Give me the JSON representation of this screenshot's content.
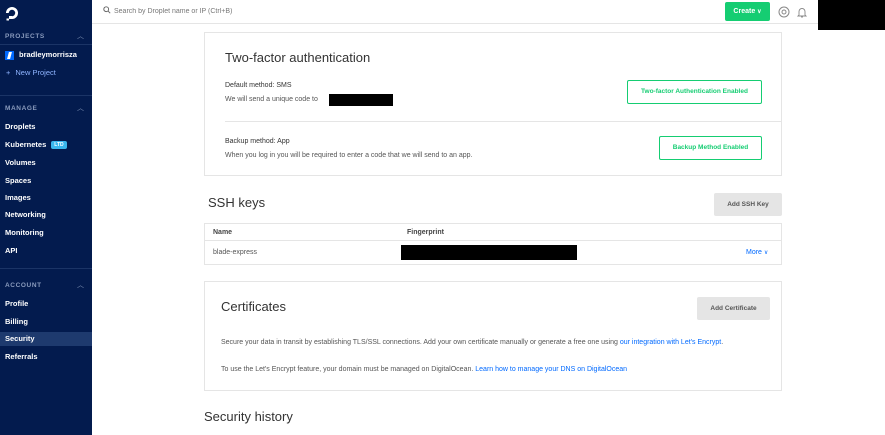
{
  "sidebar": {
    "projects_label": "PROJECTS",
    "project_name": "bradleymorrisza",
    "new_project": "New Project",
    "manage_label": "MANAGE",
    "manage_items": [
      "Droplets",
      "Kubernetes",
      "Volumes",
      "Spaces",
      "Images",
      "Networking",
      "Monitoring",
      "API"
    ],
    "kubernetes_badge": "LTD",
    "account_label": "ACCOUNT",
    "account_items": [
      "Profile",
      "Billing",
      "Security",
      "Referrals"
    ],
    "active_item": "Security",
    "colors": {
      "background": "#031b4e",
      "active": "#1e3a6e"
    }
  },
  "topbar": {
    "search_placeholder": "Search by Droplet name or IP (Ctrl+B)",
    "create_label": "Create",
    "icons": [
      "search-icon",
      "help-icon",
      "notification-bell-icon"
    ],
    "accent": "#15cd72"
  },
  "two_factor": {
    "title": "Two-factor authentication",
    "default_method_label": "Default method: SMS",
    "default_method_desc": "We will send a unique code to",
    "default_button": "Two-factor Authentication Enabled",
    "backup_method_label": "Backup method: App",
    "backup_method_desc": "When you log in you will be required to enter a code that we will send to an app.",
    "backup_button": "Backup Method Enabled"
  },
  "ssh_keys": {
    "title": "SSH keys",
    "add_button": "Add SSH Key",
    "columns": [
      "Name",
      "Fingerprint"
    ],
    "rows": [
      {
        "name": "blade-express",
        "more": "More"
      }
    ]
  },
  "certificates": {
    "title": "Certificates",
    "add_button": "Add Certificate",
    "desc_prefix": "Secure your data in transit by establishing TLS/SSL connections. Add your own certificate manually or generate a free one using ",
    "desc_link": "our integration with Let's Encrypt",
    "desc_suffix": ".",
    "note_prefix": "To use the Let's Encrypt feature, your domain must be managed on DigitalOcean. ",
    "note_link": "Learn how to manage your DNS on DigitalOcean"
  },
  "security_history": {
    "title": "Security history"
  }
}
